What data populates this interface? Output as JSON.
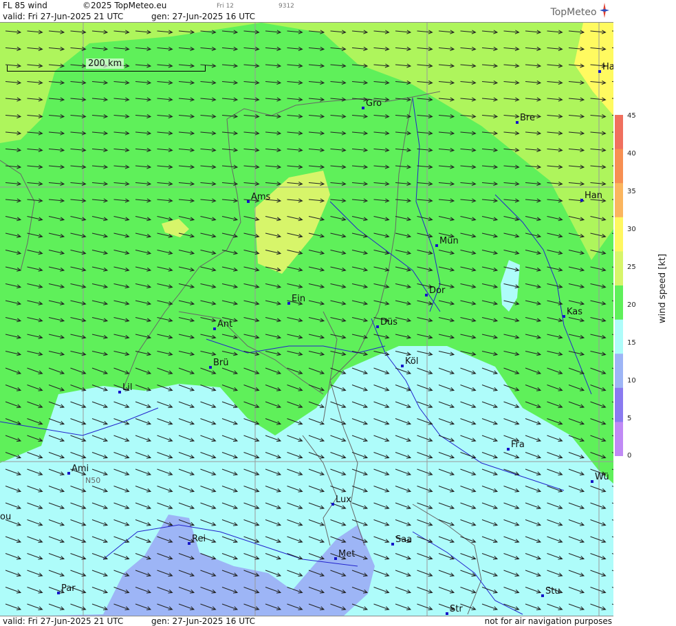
{
  "header": {
    "product": "FL 85 wind",
    "copyright": "©2025 TopMeteo.eu",
    "small_a": "Fri 12",
    "small_b": "9312",
    "valid": "valid:  Fri  27-Jun-2025  21 UTC",
    "gen": "gen: 27-Jun-2025 16 UTC",
    "logo": "TopMeteo"
  },
  "footer": {
    "valid": "valid:  Fri  27-Jun-2025  21 UTC",
    "gen": "gen: 27-Jun-2025 16 UTC",
    "note": "not for air navigation purposes"
  },
  "map": {
    "scale_label": "200 km",
    "latitude_label": "N50",
    "cities": [
      "Ha",
      "Gro",
      "Bre",
      "Ams",
      "Han",
      "Mün",
      "Dor",
      "Ein",
      "Kas",
      "Düs",
      "Ant",
      "Köl",
      "Brü",
      "Lil",
      "Fra",
      "Ami",
      "Wü",
      "Lux",
      "ou",
      "Rei",
      "Saa",
      "Met",
      "Par",
      "Stu",
      "Str"
    ],
    "wind_direction": "west-northwest",
    "colors": {
      "green": "#5ff05a",
      "light_green": "#aef55c",
      "yellow_green": "#d7f56a",
      "yellow": "#fffa60",
      "cyan": "#aefcfa",
      "blue": "#9db5f6"
    }
  },
  "legend": {
    "title": "wind speed [kt]",
    "ticks": [
      "45",
      "40",
      "35",
      "30",
      "25",
      "20",
      "15",
      "10",
      "5",
      "0"
    ],
    "colors": [
      "#f0705e",
      "#f78f52",
      "#fbb55e",
      "#fff760",
      "#d7f56a",
      "#5ff05a",
      "#aefcfa",
      "#9db5f6",
      "#8a7af0",
      "#c08af5"
    ]
  }
}
